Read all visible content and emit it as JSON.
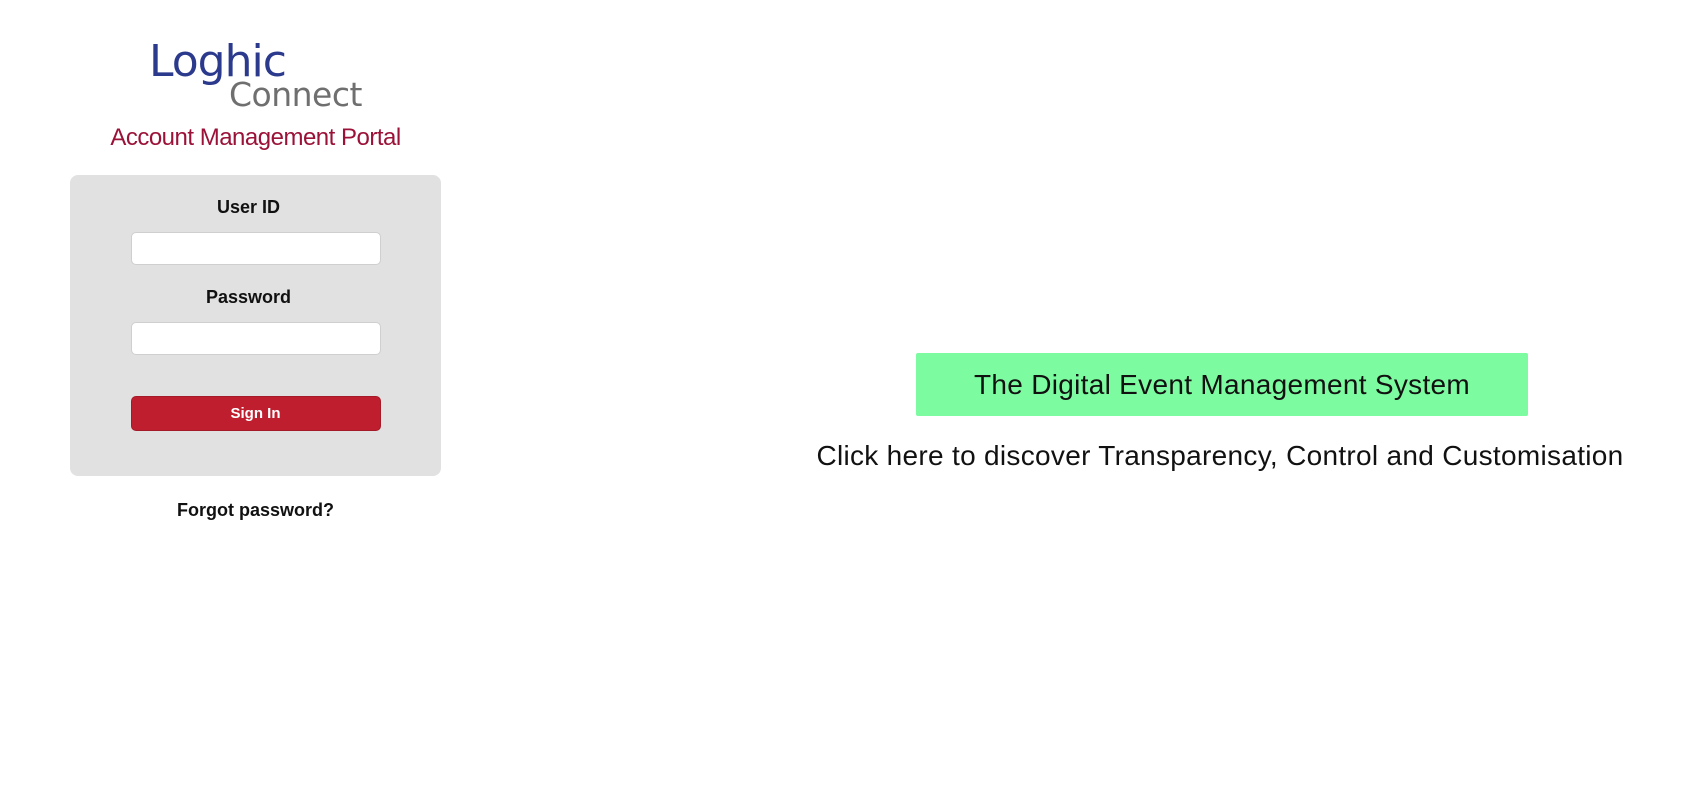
{
  "logo": {
    "line1": "Loghic",
    "line2": "Connect",
    "colors": {
      "primary": "#2b3a8c",
      "secondary": "#6f6f6f"
    }
  },
  "portal_title": "Account Management Portal",
  "login": {
    "user_id_label": "User ID",
    "user_id_value": "",
    "password_label": "Password",
    "password_value": "",
    "sign_in_label": "Sign In",
    "forgot_password": "Forgot password?"
  },
  "promo": {
    "banner_text": "The Digital Event Management System",
    "discover_text": "Click here to discover Transparency, Control and Customisation"
  },
  "colors": {
    "accent": "#bf1e2e",
    "title": "#9b1238",
    "banner": "#7dfba0",
    "card": "#e1e1e1"
  }
}
